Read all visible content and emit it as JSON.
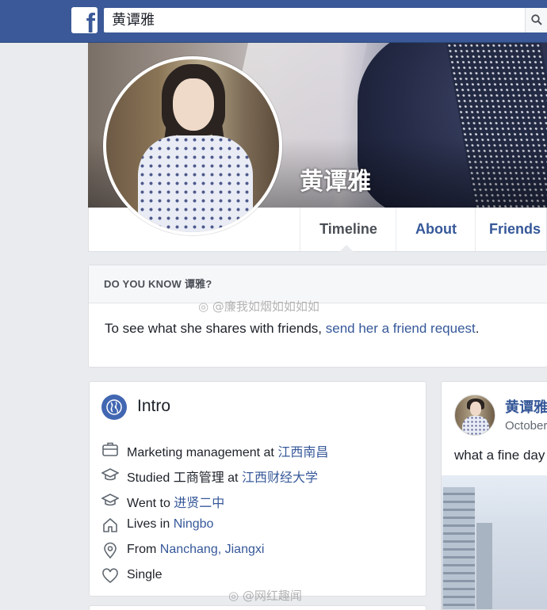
{
  "topbar": {
    "logo_letter": "f",
    "search_value": "黄谭雅"
  },
  "profile": {
    "name": "黄谭雅",
    "tabs": [
      {
        "label": "Timeline"
      },
      {
        "label": "About"
      },
      {
        "label": "Friends"
      }
    ]
  },
  "do_you_know": {
    "heading": "DO YOU KNOW 谭雅?",
    "text_prefix": "To see what she shares with friends, ",
    "link": "send her a friend request",
    "text_suffix": "."
  },
  "watermarks": [
    "@廉我如烟如如如如",
    "@网红趣闻"
  ],
  "intro": {
    "title": "Intro",
    "rows": [
      {
        "icon": "briefcase-icon",
        "prefix": "Marketing management at ",
        "link": "江西南昌"
      },
      {
        "icon": "graduation-cap-icon",
        "prefix": "Studied 工商管理 at ",
        "link": "江西财经大学"
      },
      {
        "icon": "graduation-cap-icon",
        "prefix": "Went to ",
        "link": "进贤二中"
      },
      {
        "icon": "home-icon",
        "prefix": "Lives in ",
        "link": "Ningbo"
      },
      {
        "icon": "location-pin-icon",
        "prefix": "From ",
        "link": "Nanchang, Jiangxi"
      },
      {
        "icon": "heart-icon",
        "prefix": "Single",
        "link": ""
      }
    ]
  },
  "post": {
    "author": "黄谭雅",
    "date": "October",
    "text": "what a fine day"
  },
  "colors": {
    "brand": "#3b5998",
    "link": "#365899",
    "background": "#e9ebee"
  }
}
